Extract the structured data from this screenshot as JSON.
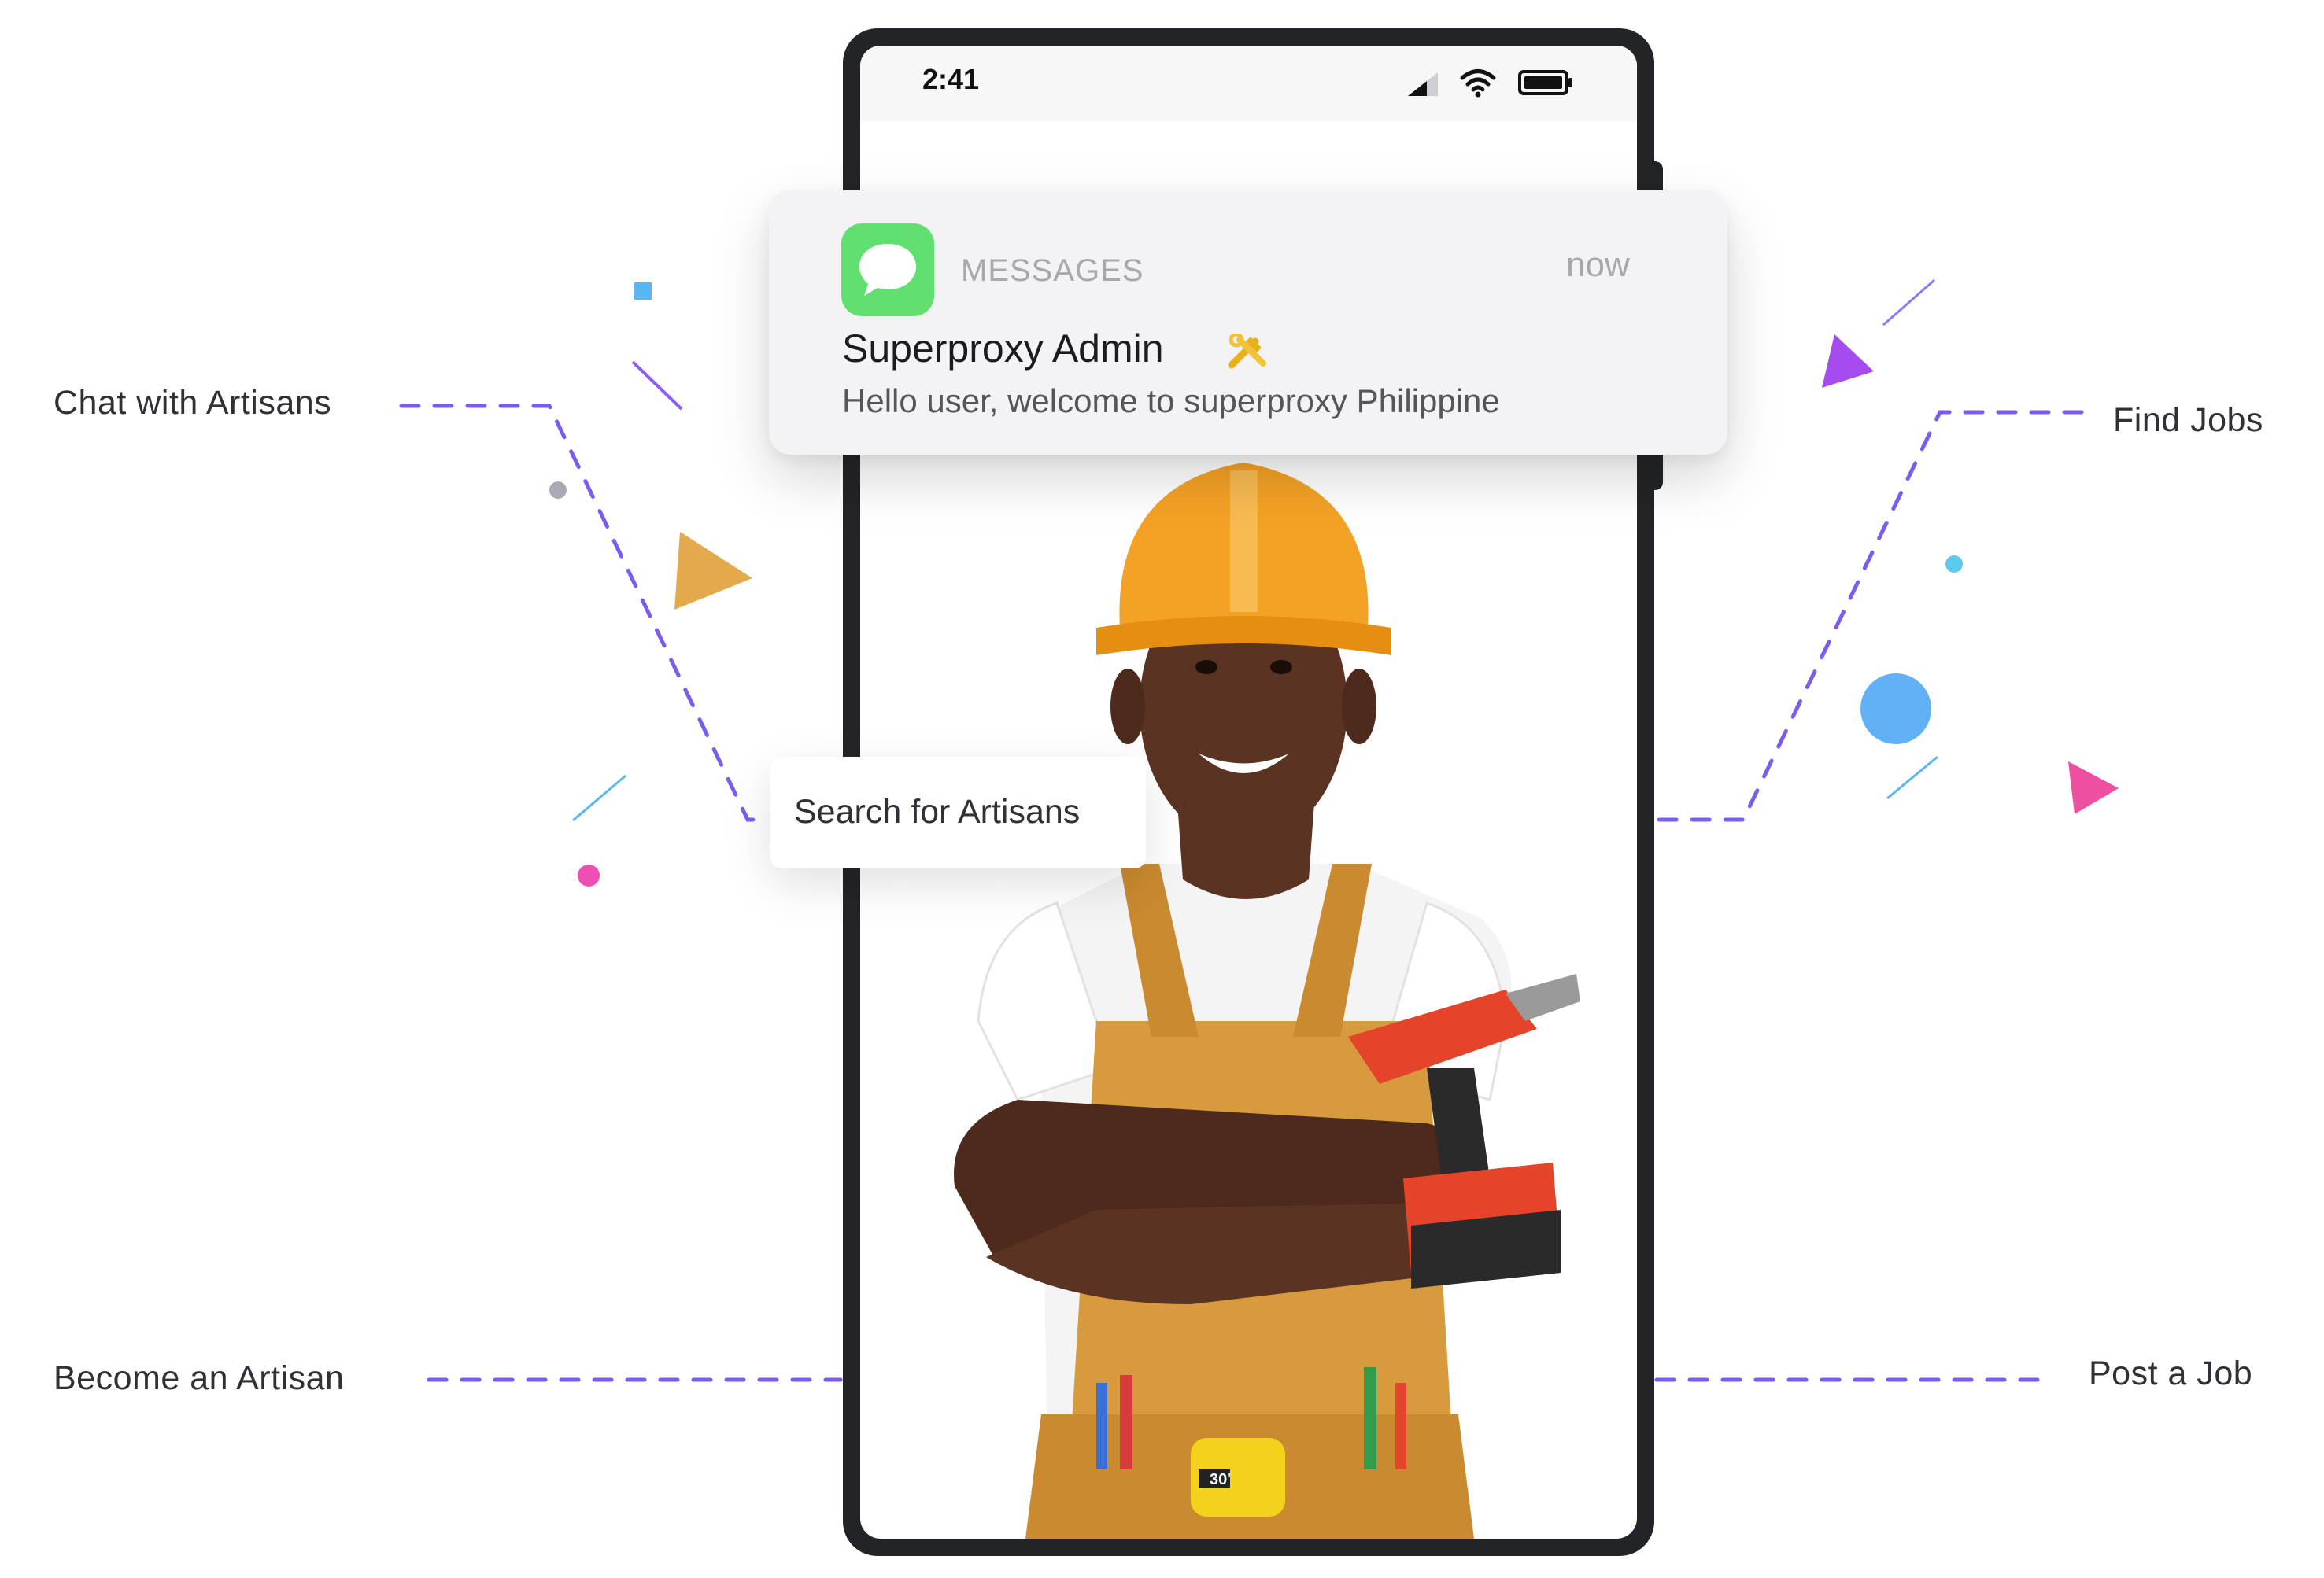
{
  "features": {
    "chat": "Chat with Artisans",
    "search": "Search for Artisans",
    "find_jobs": "Find Jobs",
    "become": "Become an Artisan",
    "post_job": "Post a Job"
  },
  "phone": {
    "status_time": "2:41"
  },
  "notification": {
    "app_name": "MESSAGES",
    "time": "now",
    "title": "Superproxy Admin",
    "body": "Hello user, welcome to superproxy Philippine",
    "title_icon": "tools-icon"
  },
  "illustration": {
    "subject": "worker-illustration",
    "tape_label": "30'"
  },
  "colors": {
    "dash_purple": "#7a5cf0",
    "message_green": "#61e06f",
    "helmet": "#f4a226",
    "overall": "#d79a3c",
    "drill": "#e6432b"
  }
}
